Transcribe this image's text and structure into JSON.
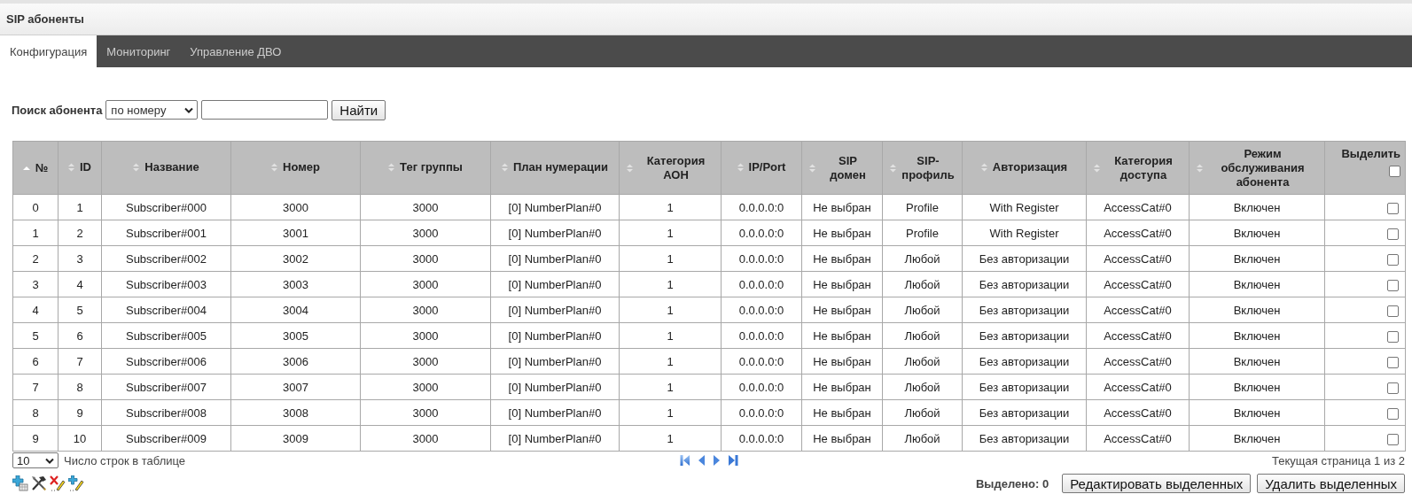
{
  "page_title": "SIP абоненты",
  "tabs": [
    {
      "label": "Конфигурация",
      "selected": true
    },
    {
      "label": "Мониторинг",
      "selected": false
    },
    {
      "label": "Управление ДВО",
      "selected": false
    }
  ],
  "search": {
    "label": "Поиск абонента",
    "mode": "по номеру",
    "button": "Найти"
  },
  "table": {
    "columns": [
      {
        "label": "№",
        "kind": "sortable",
        "sorted": true
      },
      {
        "label": "ID",
        "kind": "sortable",
        "sorted": false
      },
      {
        "label": "Название",
        "kind": "sortable",
        "sorted": false
      },
      {
        "label": "Номер",
        "kind": "sortable",
        "sorted": false
      },
      {
        "label": "Тег группы",
        "kind": "sortable",
        "sorted": false
      },
      {
        "label": "План нумерации",
        "kind": "sortable",
        "sorted": false
      },
      {
        "label": "Категория АОН",
        "kind": "sortable",
        "sorted": false
      },
      {
        "label": "IP/Port",
        "kind": "sortable",
        "sorted": false
      },
      {
        "label": "SIP домен",
        "kind": "sortable",
        "sorted": false
      },
      {
        "label": "SIP-профиль",
        "kind": "sortable",
        "sorted": false
      },
      {
        "label": "Авторизация",
        "kind": "sortable",
        "sorted": false
      },
      {
        "label": "Категория доступа",
        "kind": "sortable",
        "sorted": false
      },
      {
        "label": "Режим обслуживания абонента",
        "kind": "sortable",
        "sorted": false
      },
      {
        "label": "Выделить",
        "kind": "select",
        "checked": false
      }
    ],
    "rows": [
      {
        "cells": [
          "0",
          "1",
          "Subscriber#000",
          "3000",
          "3000",
          "[0] NumberPlan#0",
          "1",
          "0.0.0.0:0",
          "Не выбран",
          "Profile",
          "With Register",
          "AccessCat#0",
          "Включен"
        ],
        "selected": false
      },
      {
        "cells": [
          "1",
          "2",
          "Subscriber#001",
          "3001",
          "3000",
          "[0] NumberPlan#0",
          "1",
          "0.0.0.0:0",
          "Не выбран",
          "Profile",
          "With Register",
          "AccessCat#0",
          "Включен"
        ],
        "selected": false
      },
      {
        "cells": [
          "2",
          "3",
          "Subscriber#002",
          "3002",
          "3000",
          "[0] NumberPlan#0",
          "1",
          "0.0.0.0:0",
          "Не выбран",
          "Любой",
          "Без авторизации",
          "AccessCat#0",
          "Включен"
        ],
        "selected": false
      },
      {
        "cells": [
          "3",
          "4",
          "Subscriber#003",
          "3003",
          "3000",
          "[0] NumberPlan#0",
          "1",
          "0.0.0.0:0",
          "Не выбран",
          "Любой",
          "Без авторизации",
          "AccessCat#0",
          "Включен"
        ],
        "selected": false
      },
      {
        "cells": [
          "4",
          "5",
          "Subscriber#004",
          "3004",
          "3000",
          "[0] NumberPlan#0",
          "1",
          "0.0.0.0:0",
          "Не выбран",
          "Любой",
          "Без авторизации",
          "AccessCat#0",
          "Включен"
        ],
        "selected": false
      },
      {
        "cells": [
          "5",
          "6",
          "Subscriber#005",
          "3005",
          "3000",
          "[0] NumberPlan#0",
          "1",
          "0.0.0.0:0",
          "Не выбран",
          "Любой",
          "Без авторизации",
          "AccessCat#0",
          "Включен"
        ],
        "selected": false
      },
      {
        "cells": [
          "6",
          "7",
          "Subscriber#006",
          "3006",
          "3000",
          "[0] NumberPlan#0",
          "1",
          "0.0.0.0:0",
          "Не выбран",
          "Любой",
          "Без авторизации",
          "AccessCat#0",
          "Включен"
        ],
        "selected": false
      },
      {
        "cells": [
          "7",
          "8",
          "Subscriber#007",
          "3007",
          "3000",
          "[0] NumberPlan#0",
          "1",
          "0.0.0.0:0",
          "Не выбран",
          "Любой",
          "Без авторизации",
          "AccessCat#0",
          "Включен"
        ],
        "selected": false
      },
      {
        "cells": [
          "8",
          "9",
          "Subscriber#008",
          "3008",
          "3000",
          "[0] NumberPlan#0",
          "1",
          "0.0.0.0:0",
          "Не выбран",
          "Любой",
          "Без авторизации",
          "AccessCat#0",
          "Включен"
        ],
        "selected": false
      },
      {
        "cells": [
          "9",
          "10",
          "Subscriber#009",
          "3009",
          "3000",
          "[0] NumberPlan#0",
          "1",
          "0.0.0.0:0",
          "Не выбран",
          "Любой",
          "Без авторизации",
          "AccessCat#0",
          "Включен"
        ],
        "selected": false
      }
    ]
  },
  "footer": {
    "page_size": "10",
    "page_size_label": "Число строк в таблице",
    "page_info": "Текущая страница 1 из 2",
    "selected_count": "Выделено: 0",
    "buttons": [
      "Редактировать выделенных",
      "Удалить выделенных"
    ]
  }
}
